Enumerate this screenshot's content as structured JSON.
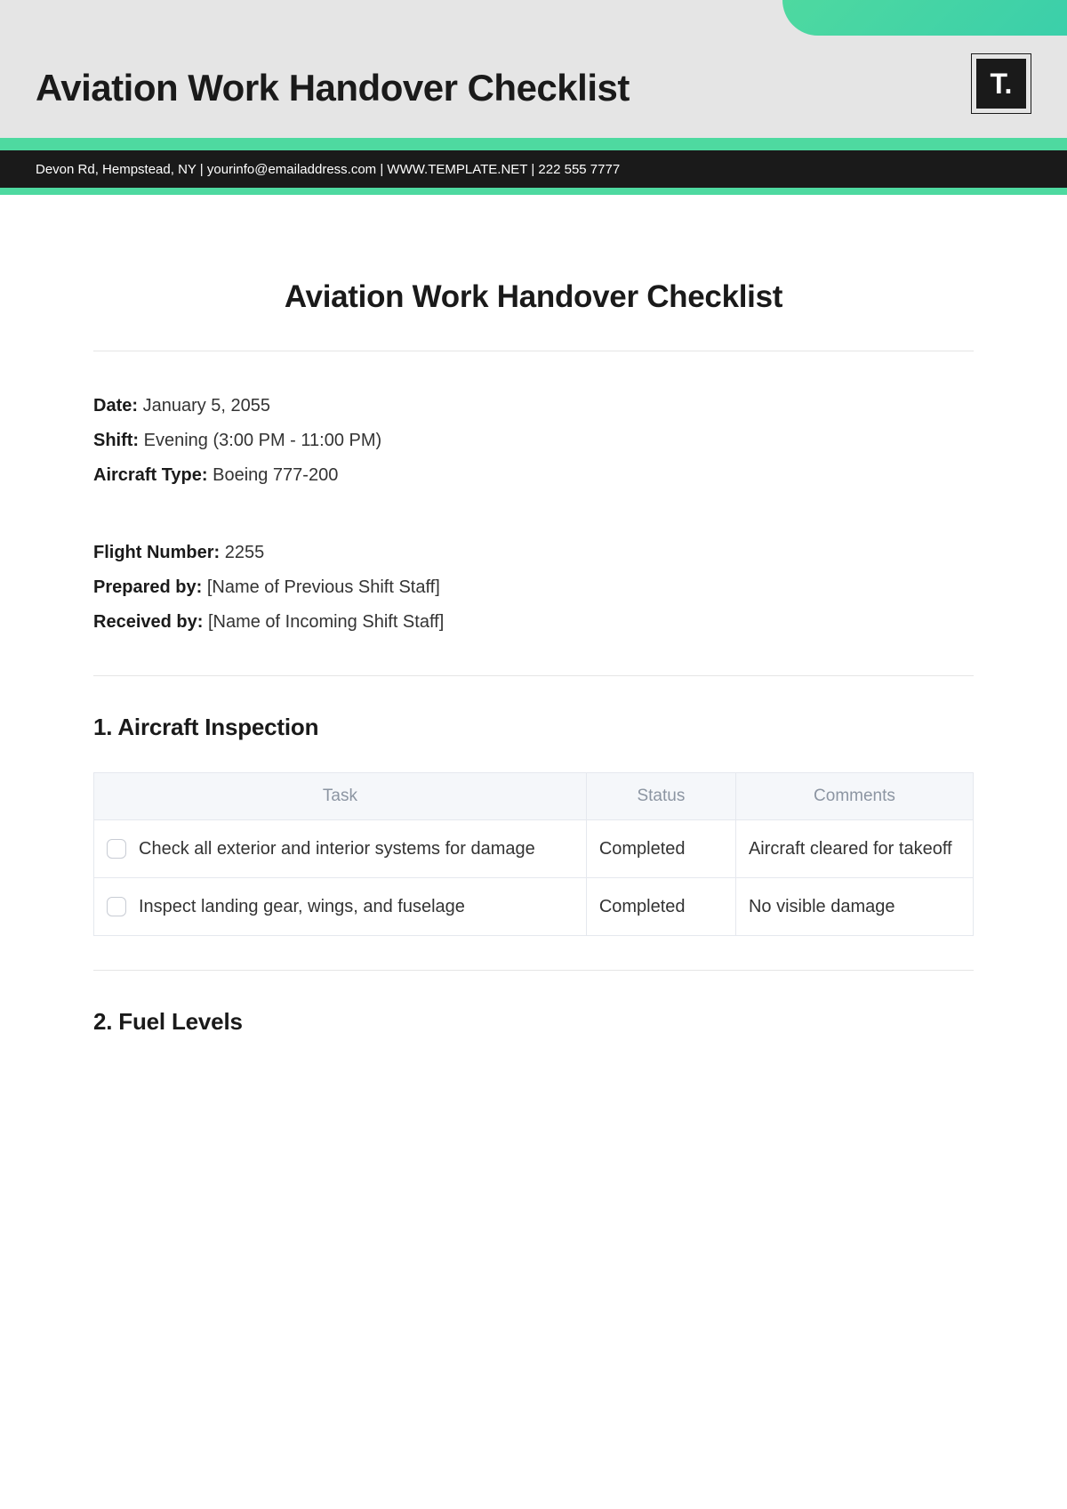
{
  "header": {
    "title": "Aviation Work Handover Checklist",
    "logo_text": "T.",
    "contact_line": "Devon Rd, Hempstead, NY | yourinfo@emailaddress.com | WWW.TEMPLATE.NET | 222 555 7777"
  },
  "document": {
    "title": "Aviation Work Handover Checklist"
  },
  "meta": {
    "date_label": "Date:",
    "date_value": " January 5, 2055",
    "shift_label": "Shift:",
    "shift_value": " Evening (3:00 PM - 11:00 PM)",
    "aircraft_label": "Aircraft Type:",
    "aircraft_value": " Boeing 777-200",
    "flight_label": "Flight Number:",
    "flight_value": " 2255",
    "prepared_label": "Prepared by:",
    "prepared_value": " [Name of Previous Shift Staff]",
    "received_label": "Received by:",
    "received_value": " [Name of Incoming Shift Staff]"
  },
  "sections": [
    {
      "heading": "1. Aircraft Inspection",
      "columns": {
        "task": "Task",
        "status": "Status",
        "comments": "Comments"
      },
      "rows": [
        {
          "task": " Check all exterior and interior systems for damage",
          "status": "Completed",
          "comments": "Aircraft cleared for takeoff"
        },
        {
          "task": "Inspect landing gear, wings, and fuselage",
          "status": "Completed",
          "comments": "No visible damage"
        }
      ]
    },
    {
      "heading": "2. Fuel Levels"
    }
  ]
}
